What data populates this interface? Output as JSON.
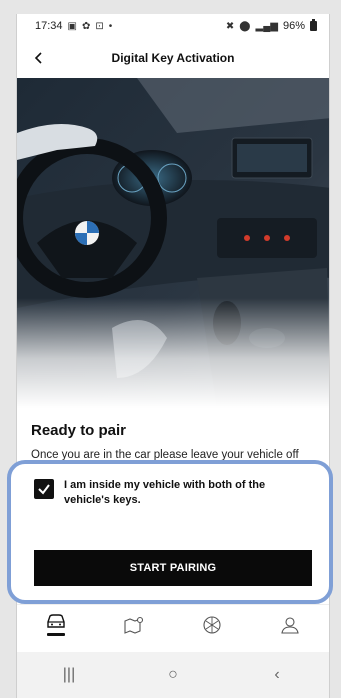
{
  "status_bar": {
    "time": "17:34",
    "left_icons": [
      "gallery-icon",
      "settings-icon",
      "cast-icon",
      "dot-icon"
    ],
    "right_icons": [
      "mute-icon",
      "location-icon",
      "lte-signal-icon"
    ],
    "battery": "96%"
  },
  "header": {
    "title": "Digital Key Activation",
    "back_icon": "chevron-left-icon"
  },
  "hero": {
    "image": "car-interior-photo",
    "colors": {
      "dark": "#1b2430",
      "dash": "#2a3440",
      "accent": "#d23b2b"
    }
  },
  "content": {
    "heading": "Ready to pair",
    "description": "Once you are in the car please leave your vehicle off until the set-up process is finished."
  },
  "checkbox": {
    "checked": true,
    "label": "I am inside my vehicle with both of the vehicle's keys."
  },
  "primary_button": {
    "label": "START PAIRING"
  },
  "highlight_color": "#7f9fd6",
  "tabs": [
    {
      "icon": "car-icon",
      "active": true
    },
    {
      "icon": "map-pin-icon",
      "active": false
    },
    {
      "icon": "globe-icon",
      "active": false
    },
    {
      "icon": "profile-icon",
      "active": false
    }
  ],
  "system_nav": [
    {
      "icon": "recents-icon",
      "glyph": "|||"
    },
    {
      "icon": "home-icon",
      "glyph": "○"
    },
    {
      "icon": "back-icon",
      "glyph": "‹"
    }
  ]
}
